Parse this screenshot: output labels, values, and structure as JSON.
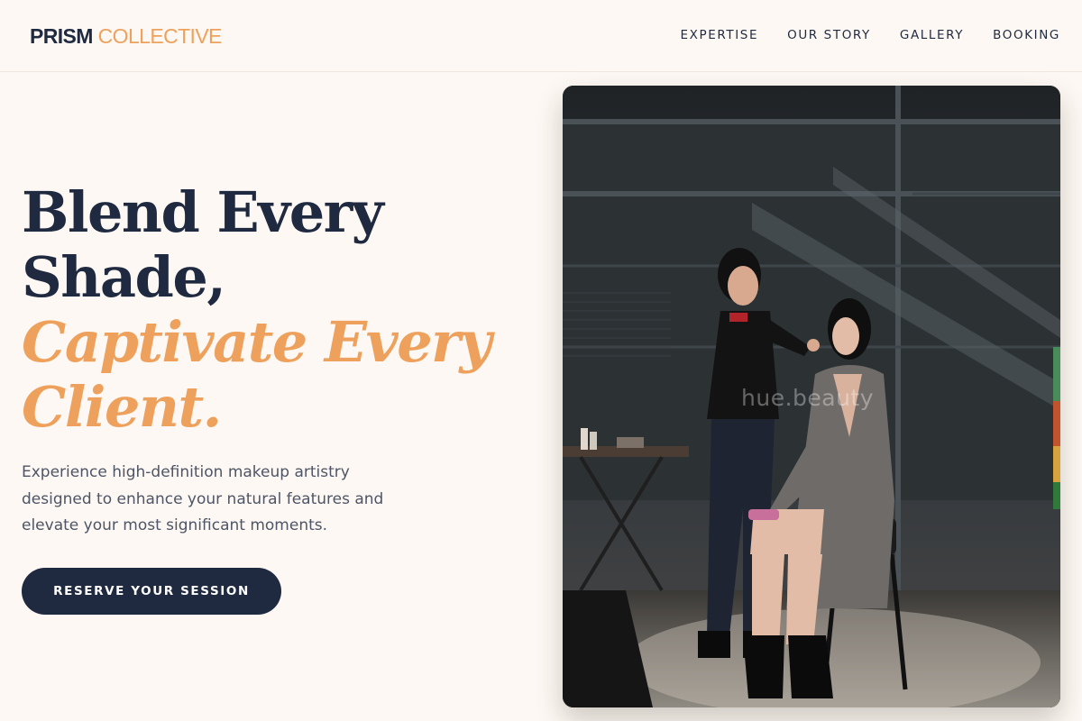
{
  "brand": {
    "name_dark": "PRISM",
    "name_accent": "COLLECTIVE"
  },
  "nav": [
    {
      "label": "EXPERTISE"
    },
    {
      "label": "OUR STORY"
    },
    {
      "label": "GALLERY"
    },
    {
      "label": "BOOKING"
    }
  ],
  "hero": {
    "title_line1": "Blend Every",
    "title_line2": "Shade,",
    "title_accent_line1": "Captivate Every",
    "title_accent_line2": "Client.",
    "description": "Experience high-definition makeup artistry designed to enhance your natural features and elevate your most significant moments.",
    "cta_label": "RESERVE YOUR SESSION"
  },
  "photo": {
    "watermark": "hue.beauty"
  },
  "colors": {
    "background": "#fdf8f3",
    "navy": "#1f2a40",
    "accent": "#eea15c",
    "body_text": "#4d5566"
  }
}
